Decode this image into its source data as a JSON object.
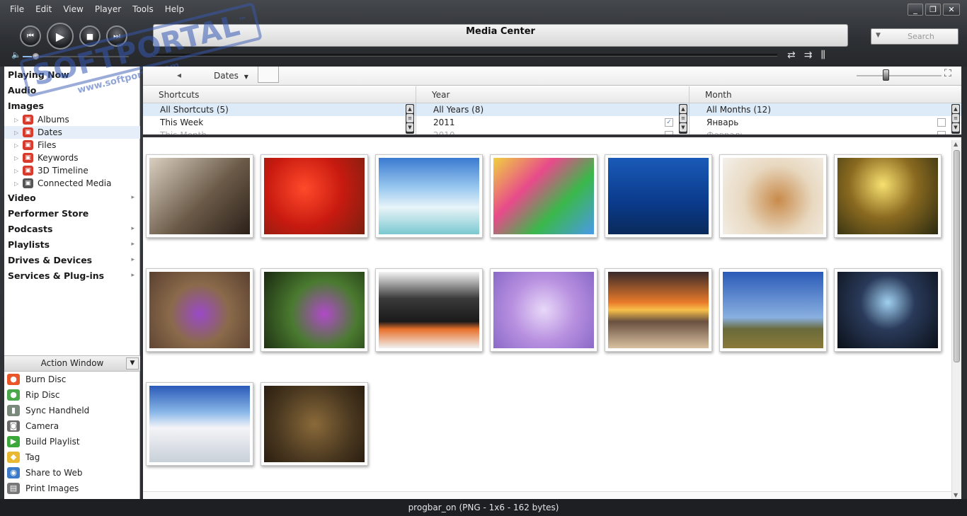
{
  "menu": [
    "File",
    "Edit",
    "View",
    "Player",
    "Tools",
    "Help"
  ],
  "window": {
    "minimize": "_",
    "restore": "❐",
    "close": "✕"
  },
  "player": {
    "display_title": "Media Center",
    "search_placeholder": "Search",
    "volume_level": 0.12,
    "seek_progress": 0.0
  },
  "tree": {
    "top_items": [
      {
        "label": "Playing Now",
        "arrow": ""
      },
      {
        "label": "Audio",
        "arrow": ""
      },
      {
        "label": "Images",
        "arrow": ""
      }
    ],
    "image_children": [
      {
        "label": "Albums",
        "icon": "album-icon",
        "selected": false
      },
      {
        "label": "Dates",
        "icon": "calendar-icon",
        "selected": true
      },
      {
        "label": "Files",
        "icon": "files-icon",
        "selected": false
      },
      {
        "label": "Keywords",
        "icon": "keywords-icon",
        "selected": false
      },
      {
        "label": "3D Timeline",
        "icon": "timeline-icon",
        "selected": false
      },
      {
        "label": "Connected Media",
        "icon": "connected-media-icon",
        "selected": false
      }
    ],
    "bottom_items": [
      {
        "label": "Video",
        "arrow": "▸"
      },
      {
        "label": "Performer Store",
        "arrow": ""
      },
      {
        "label": "Podcasts",
        "arrow": "▸"
      },
      {
        "label": "Playlists",
        "arrow": "▸"
      },
      {
        "label": "Drives & Devices",
        "arrow": "▸"
      },
      {
        "label": "Services & Plug-ins",
        "arrow": "▸"
      }
    ]
  },
  "action_window": {
    "title": "Action Window",
    "items": [
      {
        "label": "Burn Disc",
        "icon": "burn-disc-icon",
        "color": "#e8562a"
      },
      {
        "label": "Rip Disc",
        "icon": "rip-disc-icon",
        "color": "#4aa84a"
      },
      {
        "label": "Sync Handheld",
        "icon": "handheld-icon",
        "color": "#7a8a7a"
      },
      {
        "label": "Camera",
        "icon": "camera-icon",
        "color": "#6a6a6a"
      },
      {
        "label": "Build Playlist",
        "icon": "playlist-icon",
        "color": "#3aa83a"
      },
      {
        "label": "Tag",
        "icon": "tag-icon",
        "color": "#e8b830"
      },
      {
        "label": "Share to Web",
        "icon": "share-web-icon",
        "color": "#3a7ac8"
      },
      {
        "label": "Print Images",
        "icon": "printer-icon",
        "color": "#777777"
      }
    ]
  },
  "toolbar": {
    "view_label": "Dates",
    "zoom_level": 0.33
  },
  "filters": [
    {
      "header": "Shortcuts",
      "rows": [
        {
          "label": "All Shortcuts (5)",
          "selected": true,
          "checked": null
        },
        {
          "label": "This Week",
          "selected": false,
          "checked": null
        },
        {
          "label": "This Month",
          "selected": false,
          "faded": true,
          "checked": null
        }
      ]
    },
    {
      "header": "Year",
      "rows": [
        {
          "label": "All Years (8)",
          "selected": true,
          "checked": null
        },
        {
          "label": "2011",
          "selected": false,
          "checked": true
        },
        {
          "label": "2010",
          "selected": false,
          "faded": true,
          "checked": false
        }
      ]
    },
    {
      "header": "Month",
      "rows": [
        {
          "label": "All Months (12)",
          "selected": true,
          "checked": null
        },
        {
          "label": "Январь",
          "selected": false,
          "checked": false
        },
        {
          "label": "Февраль",
          "selected": false,
          "faded": true,
          "checked": false
        }
      ]
    }
  ],
  "thumbnails": [
    {
      "name": "thumb-woman-portrait",
      "bg": "linear-gradient(135deg,#d9cfc0,#6b5a48 55%,#2b2018)"
    },
    {
      "name": "thumb-red-leaves",
      "bg": "radial-gradient(circle at 40% 40%,#ff4a2a,#c81a10 50%,#7a2010)"
    },
    {
      "name": "thumb-beach-rocks",
      "bg": "linear-gradient(#3a7ad0,#9ccaf0 40%,#e8f4f8 65%,#7ac8d0)"
    },
    {
      "name": "thumb-colorful-abstract",
      "bg": "linear-gradient(135deg,#f0d040,#e84a8a 35%,#3ab84a 65%,#4a9ae8)"
    },
    {
      "name": "thumb-sea-turtle",
      "bg": "linear-gradient(#1a5ab8,#0a3a8a 60%,#0a2a5a)"
    },
    {
      "name": "thumb-puppy",
      "bg": "radial-gradient(circle at 55% 55%,#c88a4a,#e8d8c0 50%,#f4f0ea)"
    },
    {
      "name": "thumb-forest-sunlight",
      "bg": "radial-gradient(circle at 45% 35%,#f8e070,#8a6a20 45%,#2a2a10)"
    },
    {
      "name": "thumb-purple-crocus",
      "bg": "radial-gradient(circle at 50% 55%,#9a4ac8,#8a6a4a 45%,#5a4030)"
    },
    {
      "name": "thumb-butterfly-flower",
      "bg": "radial-gradient(circle at 60% 55%,#b04ac8,#4a7a30 45%,#1a2a10)"
    },
    {
      "name": "thumb-audi-car",
      "bg": "linear-gradient(#f4f4f4,#3a3a3a 35%,#1a1a1a 65%,#e8702a 75%,#f0f0f0)"
    },
    {
      "name": "thumb-lilac-flowers",
      "bg": "radial-gradient(circle at 50% 50%,#e8d8f8,#b890e0 50%,#8a6ac8)"
    },
    {
      "name": "thumb-sunset-beach",
      "bg": "linear-gradient(#3a2a2a,#e87a2a 40%,#f8c04a 50%,#6a5040 65%,#d8c0a0)"
    },
    {
      "name": "thumb-stonehenge",
      "bg": "linear-gradient(#2a5ab8,#8ab0e0 60%,#6a6a3a 75%,#8a7a3a)"
    },
    {
      "name": "thumb-dark-waterfall",
      "bg": "radial-gradient(circle at 50% 40%,#a0d0f0,#2a3a5a 40%,#0a1018)"
    },
    {
      "name": "thumb-white-dunes",
      "bg": "linear-gradient(#2a5ab8,#8ab8e8 35%,#f4f4f8 55%,#c8d0d8)"
    },
    {
      "name": "thumb-experience-water-drops",
      "bg": "radial-gradient(circle at 50% 50%,#8a6a3a,#4a3820 60%,#2a1e10)"
    }
  ],
  "status": "progbar_on (PNG - 1x6 - 162 bytes)",
  "watermark": {
    "brand": "SOFTPORTAL",
    "url": "www.softportal.com",
    "tm": "™"
  }
}
